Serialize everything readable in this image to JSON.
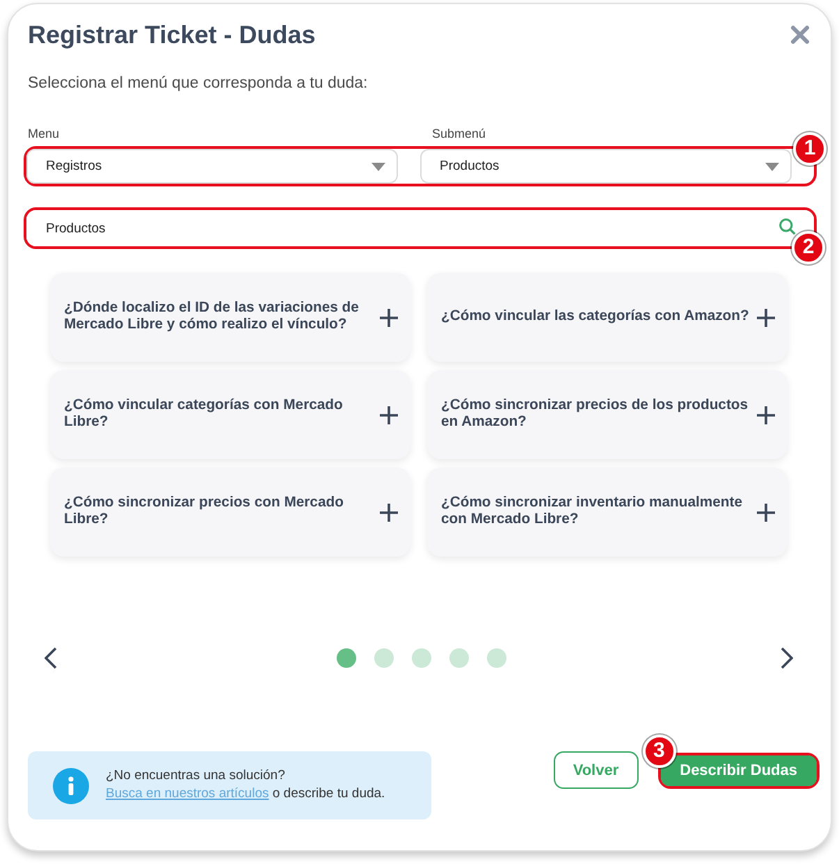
{
  "dialog": {
    "title": "Registrar Ticket - Dudas"
  },
  "instruction": "Selecciona el menú que corresponda a tu duda:",
  "selects": {
    "callout": "1",
    "items": [
      {
        "label": "Menu",
        "value": "Registros"
      },
      {
        "label": "Submenú",
        "value": "Productos"
      }
    ]
  },
  "search": {
    "value": "Productos",
    "callout": "2"
  },
  "faqs": [
    {
      "question": "¿Dónde localizo el ID de las variaciones de Mercado Libre y cómo realizo el vínculo?"
    },
    {
      "question": "¿Cómo vincular las categorías con Amazon?"
    },
    {
      "question": "¿Cómo vincular categorías con Mercado Libre?"
    },
    {
      "question": "¿Cómo sincronizar precios de los productos en Amazon?"
    },
    {
      "question": "¿Cómo sincronizar precios con Mercado Libre?"
    },
    {
      "question": "¿Cómo sincronizar inventario manualmente con Mercado Libre?"
    }
  ],
  "carousel": {
    "pages": [
      {
        "selected": true
      },
      {
        "selected": false
      },
      {
        "selected": false
      },
      {
        "selected": false
      },
      {
        "selected": false
      }
    ]
  },
  "help": {
    "text_before": "¿No encuentras una solución?",
    "link": "Busca en nuestros artículos",
    "text_after": "o describe tu duda."
  },
  "buttons": [
    {
      "label": "Volver",
      "kind": "secondary"
    },
    {
      "label": "Describir Dudas",
      "kind": "primary",
      "callout": "3"
    }
  ]
}
